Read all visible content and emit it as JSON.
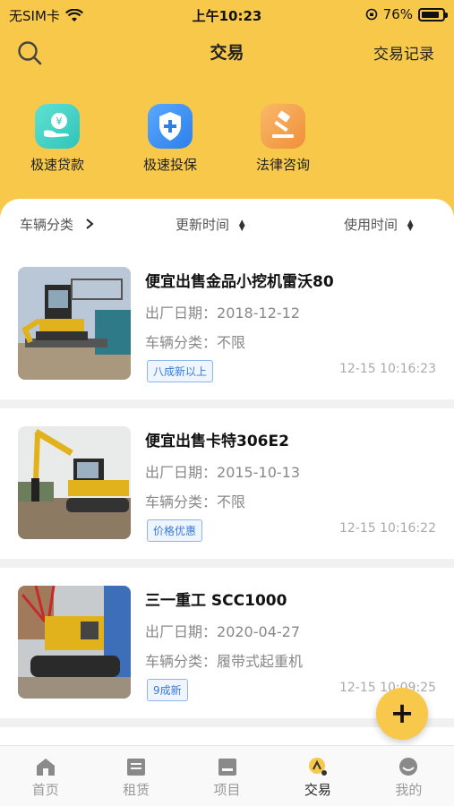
{
  "status_bar": {
    "carrier": "无SIM卡",
    "time": "上午10:23",
    "battery": "76%",
    "battery_level": 0.76
  },
  "header": {
    "title": "交易",
    "right_link": "交易记录"
  },
  "quick_actions": [
    {
      "label": "极速贷款",
      "icon": "loan-icon",
      "color": "#3FD3C6"
    },
    {
      "label": "极速投保",
      "icon": "insurance-shield-icon",
      "color": "#3A8FF2"
    },
    {
      "label": "法律咨询",
      "icon": "legal-gavel-icon",
      "color": "#F5A24A"
    }
  ],
  "filters": {
    "category": "车辆分类",
    "update_time": "更新时间",
    "use_time": "使用时间"
  },
  "listings": [
    {
      "title": "便宜出售金品小挖机雷沃80",
      "date_label": "出厂日期：",
      "date": "2018-12-12",
      "category_label": "车辆分类：",
      "category": "不限",
      "tag": "八成新以上",
      "time": "12-15 10:16:23"
    },
    {
      "title": "便宜出售卡特306E2",
      "date_label": "出厂日期：",
      "date": "2015-10-13",
      "category_label": "车辆分类：",
      "category": "不限",
      "tag": "价格优惠",
      "time": "12-15 10:16:22"
    },
    {
      "title": "三一重工 SCC1000",
      "date_label": "出厂日期：",
      "date": "2020-04-27",
      "category_label": "车辆分类：",
      "category": "履带式起重机",
      "tag": "9成新",
      "time": "12-15 10:09:25"
    }
  ],
  "fab": {
    "label": "+"
  },
  "tabbar": [
    {
      "label": "首页",
      "icon": "home-icon",
      "active": false
    },
    {
      "label": "租赁",
      "icon": "rent-icon",
      "active": false
    },
    {
      "label": "项目",
      "icon": "project-icon",
      "active": false
    },
    {
      "label": "交易",
      "icon": "trade-icon",
      "active": true
    },
    {
      "label": "我的",
      "icon": "profile-icon",
      "active": false
    }
  ],
  "colors": {
    "brand": "#F7C84A",
    "tag_blue": "#3A7BD5"
  }
}
